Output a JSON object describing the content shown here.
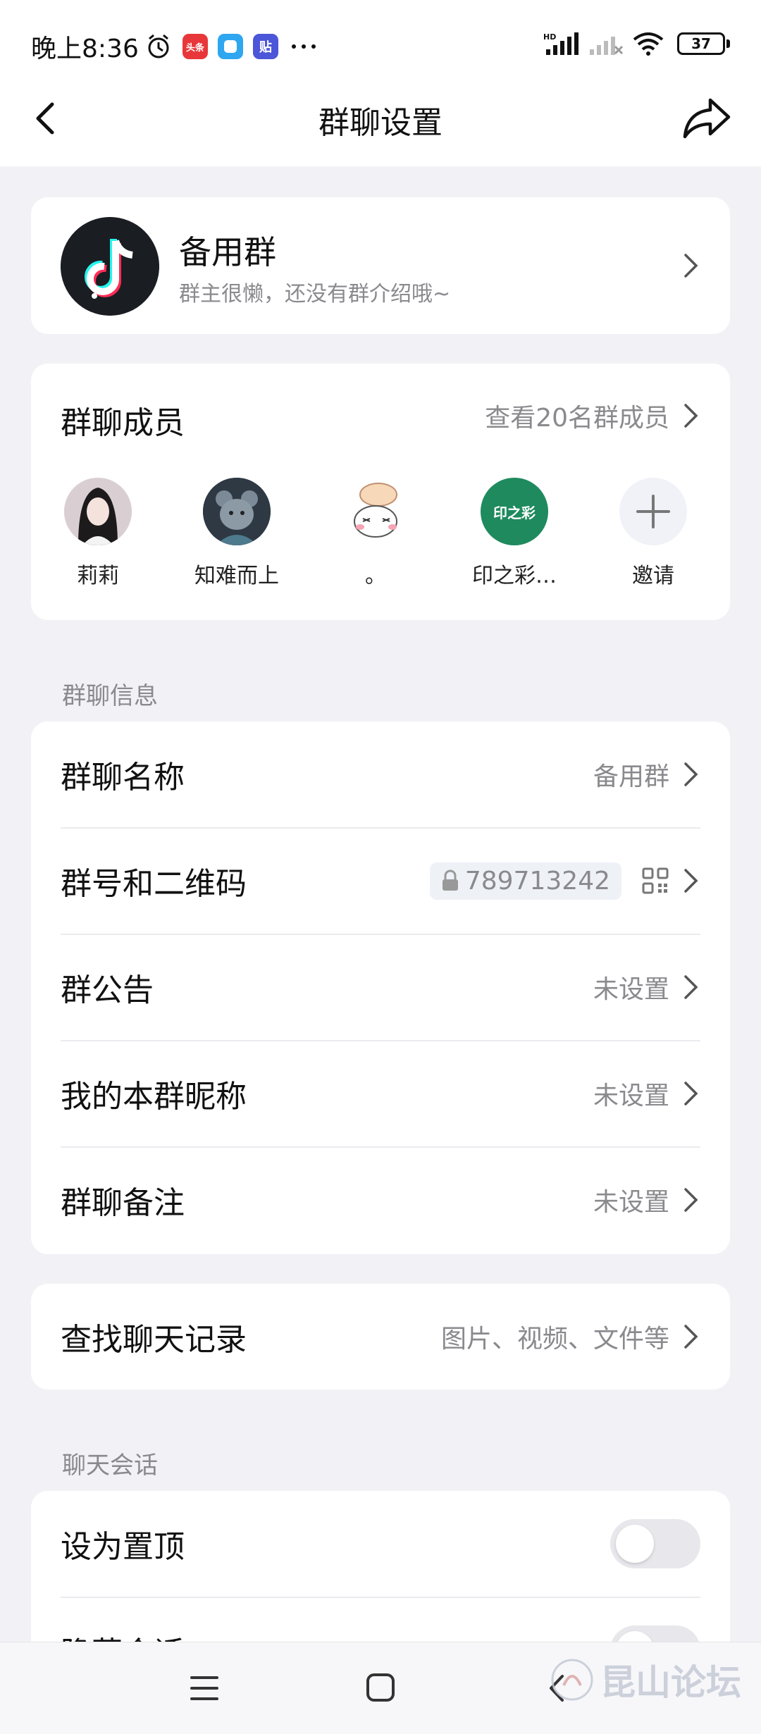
{
  "status_bar": {
    "time": "晚上8:36",
    "battery": "37",
    "notif_icons": [
      "头条",
      "",
      "贴"
    ]
  },
  "nav": {
    "title": "群聊设置"
  },
  "group": {
    "name": "备用群",
    "description": "群主很懒，还没有群介绍哦~"
  },
  "members": {
    "title": "群聊成员",
    "view_all": "查看20名群成员",
    "list": [
      {
        "name": "莉莉"
      },
      {
        "name": "知难而上"
      },
      {
        "name": "。"
      },
      {
        "name": "印之彩…"
      },
      {
        "name": "邀请"
      }
    ],
    "logo_text": "印之彩"
  },
  "info_section": {
    "header": "群聊信息",
    "rows": [
      {
        "label": "群聊名称",
        "value": "备用群"
      },
      {
        "label": "群号和二维码",
        "value": "789713242"
      },
      {
        "label": "群公告",
        "value": "未设置"
      },
      {
        "label": "我的本群昵称",
        "value": "未设置"
      },
      {
        "label": "群聊备注",
        "value": "未设置"
      }
    ]
  },
  "search_history": {
    "label": "查找聊天记录",
    "value": "图片、视频、文件等"
  },
  "session_section": {
    "header": "聊天会话",
    "rows": [
      {
        "label": "设为置顶",
        "on": false
      },
      {
        "label": "隐藏会话",
        "on": false
      }
    ]
  },
  "watermark": "昆山论坛"
}
